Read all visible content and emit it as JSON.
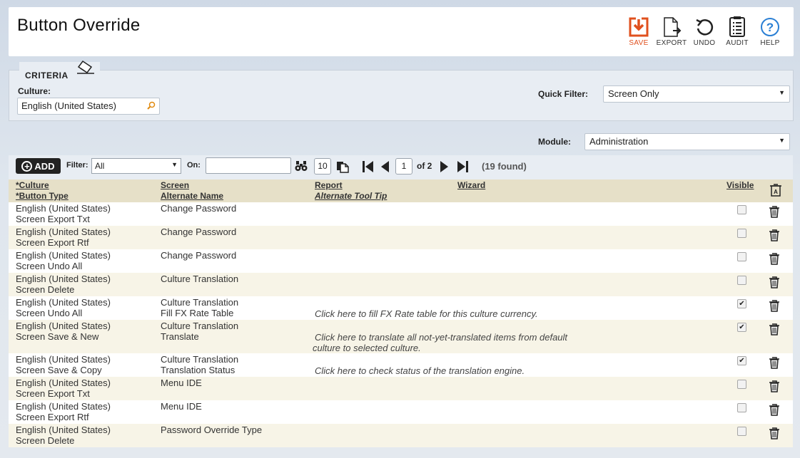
{
  "page": {
    "title": "Button Override"
  },
  "toolbar": {
    "save": "SAVE",
    "export": "EXPORT",
    "undo": "UNDO",
    "audit": "AUDIT",
    "help": "HELP",
    "save_color": "#e0501e",
    "help_color": "#2a7fd4"
  },
  "criteria": {
    "title": "CRITERIA",
    "culture_label": "Culture:",
    "culture_value": "English (United States)",
    "quick_filter_label": "Quick Filter:",
    "quick_filter_value": "Screen Only",
    "module_label": "Module:",
    "module_value": "Administration"
  },
  "grid_toolbar": {
    "add_label": "ADD",
    "filter_label": "Filter:",
    "filter_value": "All",
    "on_label": "On:",
    "on_value": "",
    "page_size": "10",
    "page_number": "1",
    "of_pages": "of 2",
    "found": "(19 found)"
  },
  "columns": {
    "culture": "*Culture",
    "button_type": "*Button Type",
    "screen": "Screen",
    "alternate_name": "Alternate Name",
    "report": "Report",
    "alternate_tool_tip": "Alternate Tool Tip",
    "wizard": "Wizard",
    "visible": "Visible"
  },
  "rows": [
    {
      "culture": "English (United States)",
      "button_type": "Screen Export Txt",
      "screen": "Change Password",
      "alternate_name": "",
      "tool_tip": "",
      "visible": false
    },
    {
      "culture": "English (United States)",
      "button_type": "Screen Export Rtf",
      "screen": "Change Password",
      "alternate_name": "",
      "tool_tip": "",
      "visible": false
    },
    {
      "culture": "English (United States)",
      "button_type": "Screen Undo All",
      "screen": "Change Password",
      "alternate_name": "",
      "tool_tip": "",
      "visible": false
    },
    {
      "culture": "English (United States)",
      "button_type": "Screen Delete",
      "screen": "Culture Translation",
      "alternate_name": "",
      "tool_tip": "",
      "visible": false
    },
    {
      "culture": "English (United States)",
      "button_type": "Screen Undo All",
      "screen": "Culture Translation",
      "alternate_name": "Fill FX Rate Table",
      "tool_tip": "Click here to fill FX Rate table for this culture currency.",
      "visible": true
    },
    {
      "culture": "English (United States)",
      "button_type": "Screen Save & New",
      "screen": "Culture Translation",
      "alternate_name": "Translate",
      "tool_tip": "Click here to translate all not-yet-translated items from default",
      "tool_tip_2": "culture to selected culture.",
      "visible": true
    },
    {
      "culture": "English (United States)",
      "button_type": "Screen Save & Copy",
      "screen": "Culture Translation",
      "alternate_name": "Translation Status",
      "tool_tip": "Click here to check status of the translation engine.",
      "visible": true
    },
    {
      "culture": "English (United States)",
      "button_type": "Screen Export Txt",
      "screen": "Menu IDE",
      "alternate_name": "",
      "tool_tip": "",
      "visible": false
    },
    {
      "culture": "English (United States)",
      "button_type": "Screen Export Rtf",
      "screen": "Menu IDE",
      "alternate_name": "",
      "tool_tip": "",
      "visible": false
    },
    {
      "culture": "English (United States)",
      "button_type": "Screen Delete",
      "screen": "Password Override Type",
      "alternate_name": "",
      "tool_tip": "",
      "visible": false
    }
  ]
}
